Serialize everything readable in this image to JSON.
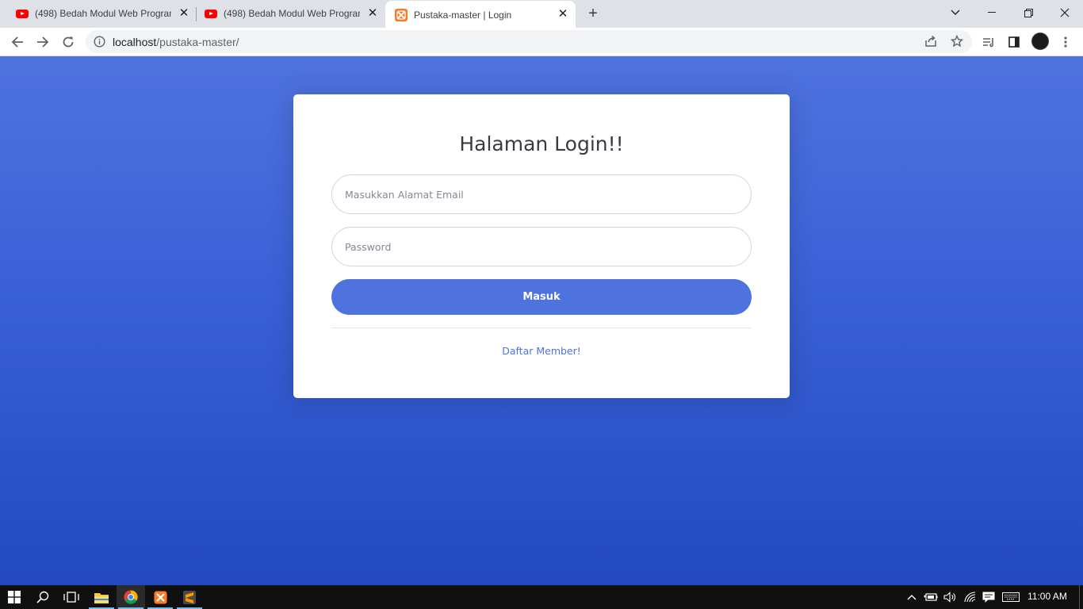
{
  "browser": {
    "tabs": [
      {
        "title": "(498) Bedah Modul Web Program",
        "favicon": "youtube-icon",
        "active": false
      },
      {
        "title": "(498) Bedah Modul Web Program",
        "favicon": "youtube-icon",
        "active": false
      },
      {
        "title": "Pustaka-master | Login",
        "favicon": "xampp-icon",
        "active": true
      }
    ],
    "new_tab_label": "+",
    "address": {
      "host": "localhost",
      "path": "/pustaka-master/"
    }
  },
  "login": {
    "title": "Halaman Login!!",
    "email_placeholder": "Masukkan Alamat Email",
    "password_placeholder": "Password",
    "submit_label": "Masuk",
    "register_link": "Daftar Member!"
  },
  "taskbar": {
    "clock": "11:00 AM"
  },
  "colors": {
    "primary": "#4e73df",
    "gradient_end": "#224abe",
    "card_bg": "#ffffff"
  }
}
